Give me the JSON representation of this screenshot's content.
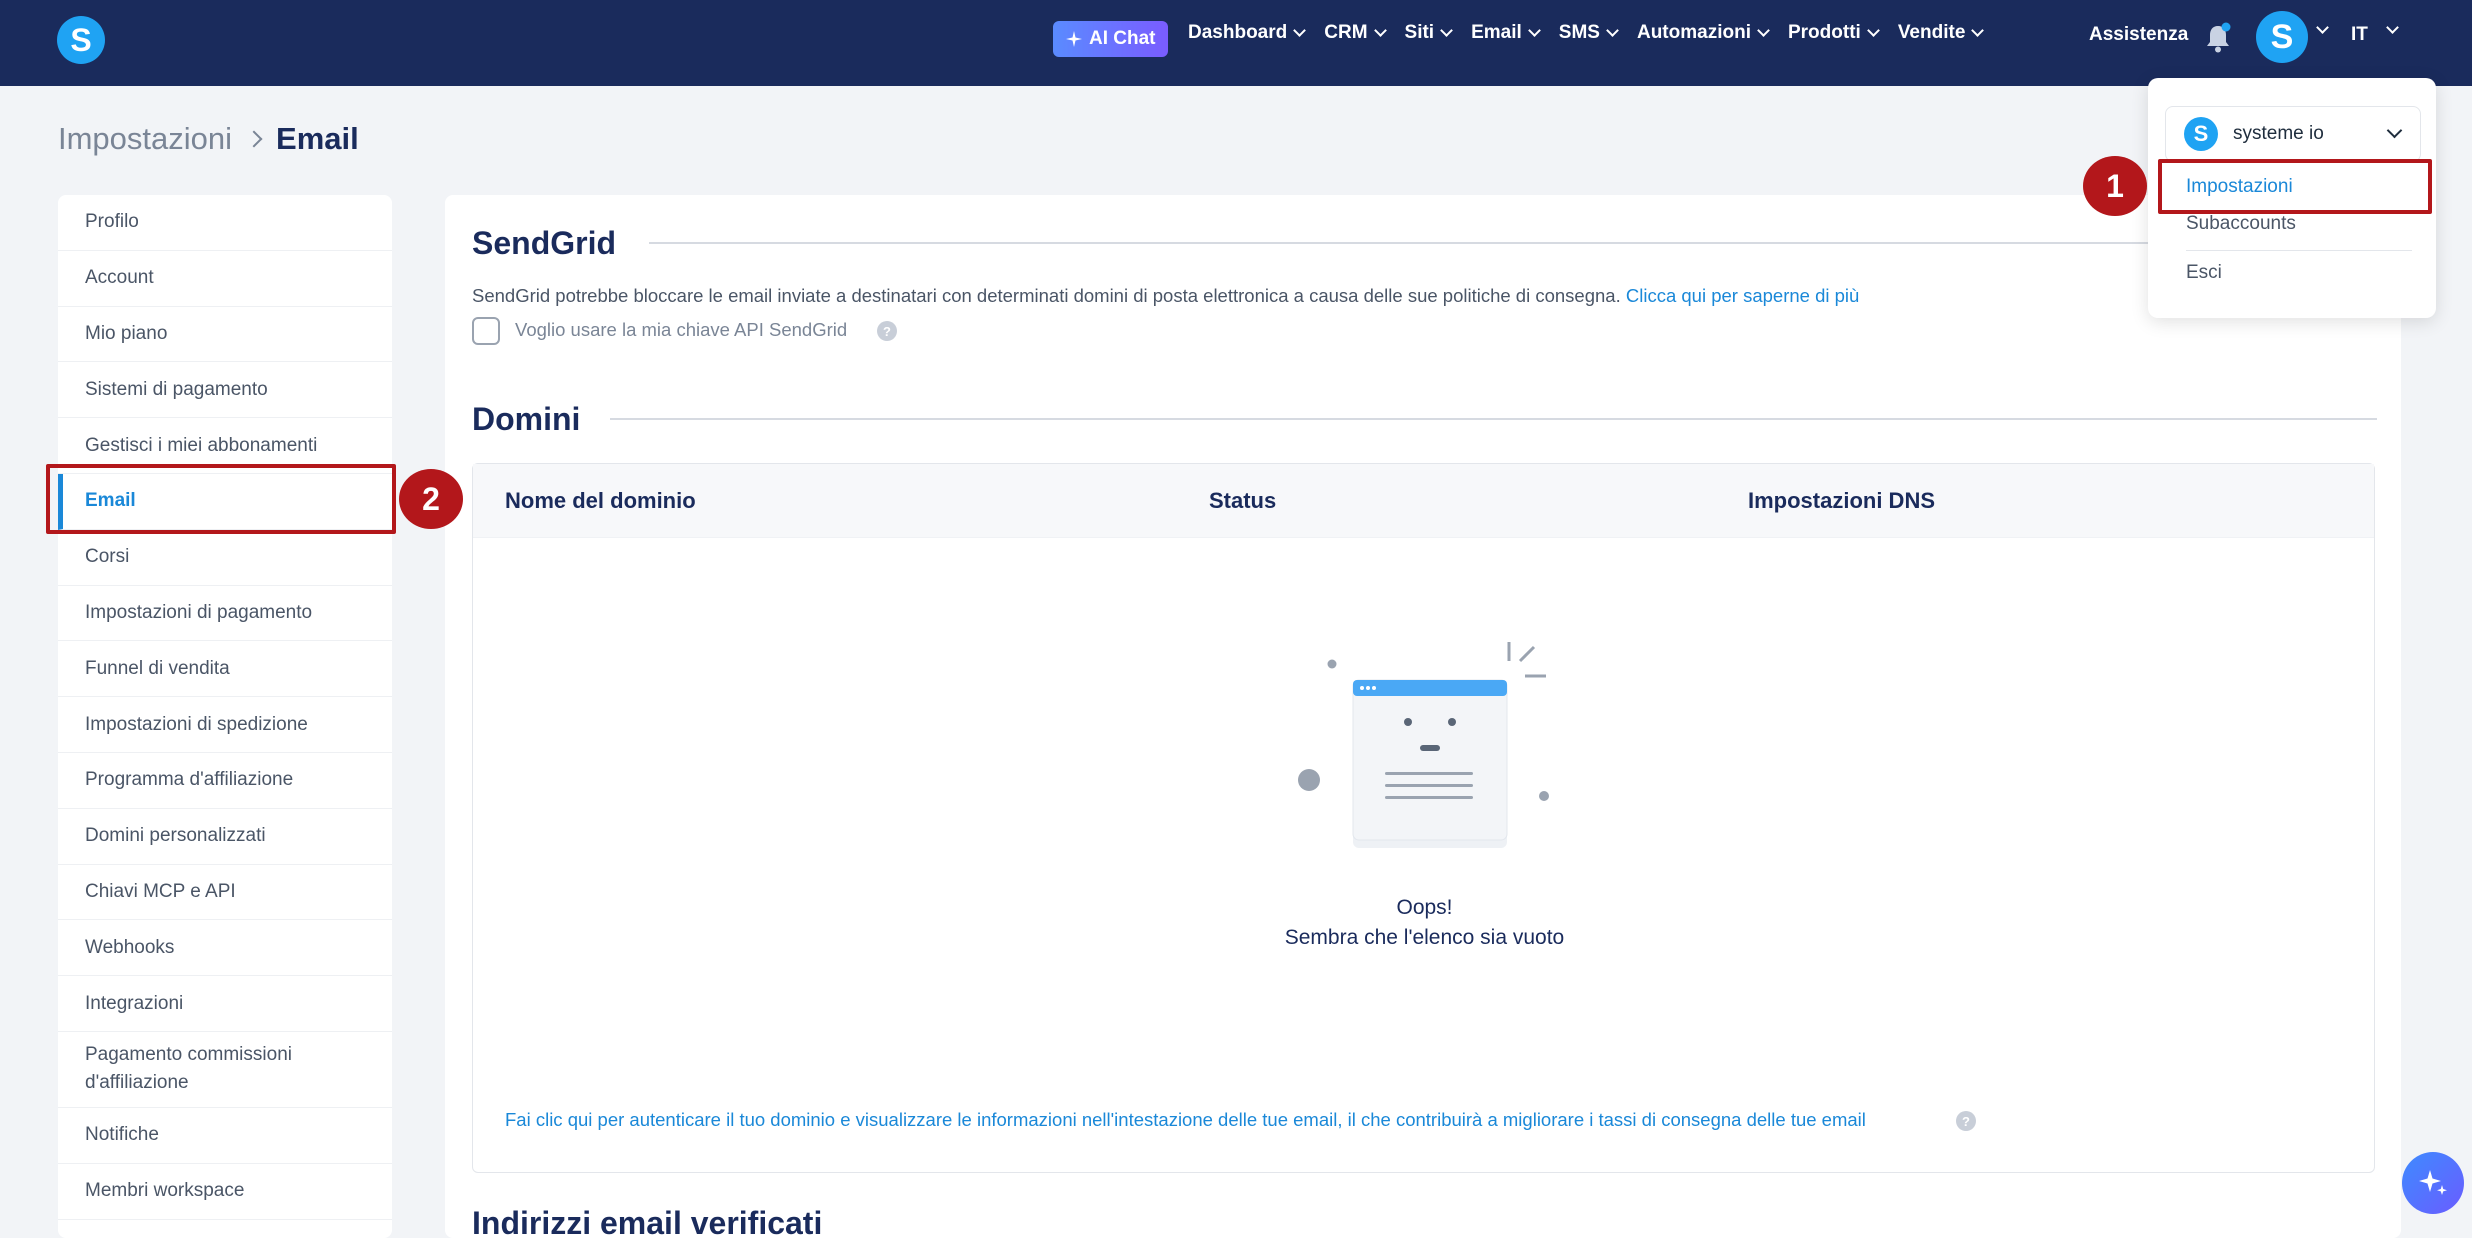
{
  "topbar": {
    "logo": "S",
    "ai_chat": "AI Chat",
    "nav": [
      {
        "label": "Dashboard"
      },
      {
        "label": "CRM"
      },
      {
        "label": "Siti"
      },
      {
        "label": "Email"
      },
      {
        "label": "SMS"
      },
      {
        "label": "Automazioni"
      },
      {
        "label": "Prodotti"
      },
      {
        "label": "Vendite"
      }
    ],
    "assistance": "Assistenza",
    "avatar": "S",
    "language": "IT"
  },
  "breadcrumb": {
    "parent": "Impostazioni",
    "current": "Email"
  },
  "sidebar": {
    "items": [
      {
        "label": "Profilo"
      },
      {
        "label": "Account"
      },
      {
        "label": "Mio piano"
      },
      {
        "label": "Sistemi di pagamento"
      },
      {
        "label": "Gestisci i miei abbonamenti"
      },
      {
        "label": "Email",
        "active": true
      },
      {
        "label": "Corsi"
      },
      {
        "label": "Impostazioni di pagamento"
      },
      {
        "label": "Funnel di vendita"
      },
      {
        "label": "Impostazioni di spedizione"
      },
      {
        "label": "Programma d'affiliazione"
      },
      {
        "label": "Domini personalizzati"
      },
      {
        "label": "Chiavi MCP e API"
      },
      {
        "label": "Webhooks"
      },
      {
        "label": "Integrazioni"
      },
      {
        "label": "Pagamento commissioni d'affiliazione"
      },
      {
        "label": "Notifiche"
      },
      {
        "label": "Membri workspace"
      }
    ]
  },
  "sendgrid": {
    "title": "SendGrid",
    "description": "SendGrid potrebbe bloccare le email inviate a destinatari con determinati domini di posta elettronica a causa delle sue politiche di consegna.",
    "learn_more": "Clicca qui per saperne di più",
    "checkbox_label": "Voglio usare la mia chiave API SendGrid",
    "checkbox_checked": false
  },
  "domains": {
    "title": "Domini",
    "columns": [
      "Nome del dominio",
      "Status",
      "Impostazioni DNS"
    ],
    "empty_title": "Oops!",
    "empty_text": "Sembra che l'elenco sia vuoto",
    "dns_link": "Fai clic qui per autenticare il tuo dominio e visualizzare le informazioni nell'intestazione delle tue email, il che contribuirà a migliorare i tassi di consegna delle tue email"
  },
  "next_section_title": "Indirizzi email verificati",
  "dropdown": {
    "workspace_logo": "S",
    "workspace": "systeme io",
    "items": [
      "Impostazioni",
      "Subaccounts",
      "Esci"
    ]
  },
  "annotations": [
    "1",
    "2"
  ],
  "colors": {
    "topbar": "#1a2b5c",
    "brand": "#1fa3f3",
    "link": "#1a88d8",
    "annotation": "#b3171b"
  },
  "help_icon_glyph": "?"
}
